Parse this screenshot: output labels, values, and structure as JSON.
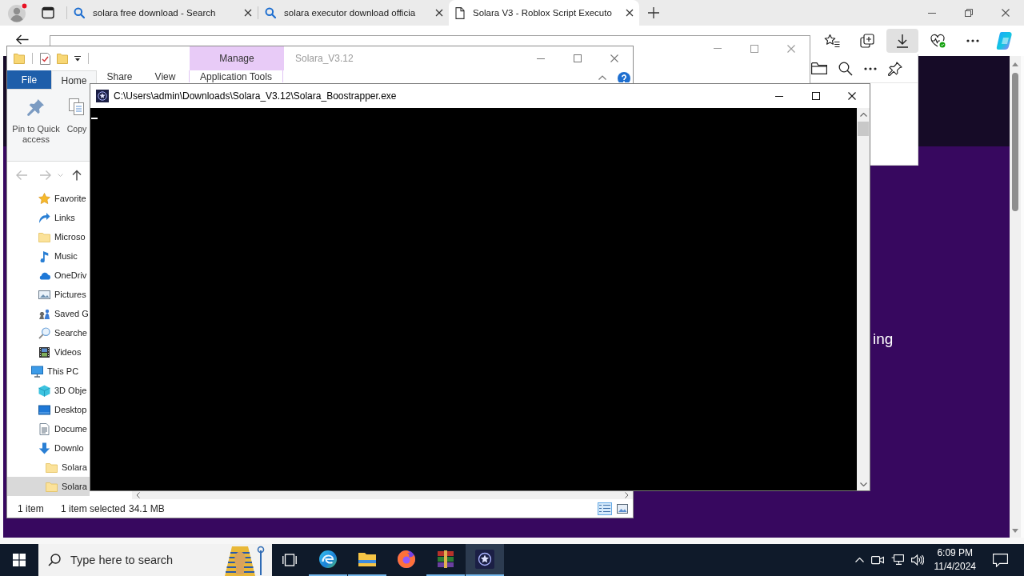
{
  "browser": {
    "tabs": [
      {
        "kind": "search",
        "title": "solara free download - Search",
        "selected": false
      },
      {
        "kind": "search",
        "title": "solara executor download officia",
        "selected": false
      },
      {
        "kind": "page",
        "title": "Solara V3 - Roblox Script Executo",
        "selected": true
      }
    ],
    "downloads_open": true,
    "page_text": "ing"
  },
  "explorer": {
    "context_group": "Manage",
    "title": "Solara_V3.12",
    "ribbon_tabs": [
      {
        "kind": "file",
        "label": "File",
        "selected": false
      },
      {
        "kind": "tab",
        "label": "Home",
        "selected": true
      },
      {
        "kind": "tab",
        "label": "Share",
        "selected": false
      },
      {
        "kind": "tab",
        "label": "View",
        "selected": false
      },
      {
        "kind": "context",
        "label": "Application Tools",
        "selected": false
      }
    ],
    "ribbon_commands": [
      {
        "kind": "pin",
        "label": "Pin to Quick access"
      },
      {
        "kind": "copy",
        "label": "Copy"
      }
    ],
    "nav_pane": {
      "branch_items": [
        {
          "kind": "star",
          "label": "Favorite",
          "selected": false
        },
        {
          "kind": "link",
          "label": "Links",
          "selected": false
        },
        {
          "kind": "folder",
          "label": "Microso",
          "selected": false
        },
        {
          "kind": "music",
          "label": "Music",
          "selected": false
        },
        {
          "kind": "cloud",
          "label": "OneDriv",
          "selected": false
        },
        {
          "kind": "pictures",
          "label": "Pictures",
          "selected": false
        },
        {
          "kind": "games",
          "label": "Saved G",
          "selected": false
        },
        {
          "kind": "search",
          "label": "Searche",
          "selected": false
        },
        {
          "kind": "videos",
          "label": "Videos",
          "selected": false
        }
      ],
      "tree": [
        {
          "kind": "pc",
          "label": "This PC",
          "selected": false,
          "children": [
            {
              "kind": "cube",
              "label": "3D Obje",
              "selected": false
            },
            {
              "kind": "desktop",
              "label": "Desktop",
              "selected": false
            },
            {
              "kind": "documents",
              "label": "Docume",
              "selected": false
            },
            {
              "kind": "downloads",
              "label": "Downlo",
              "selected": false,
              "children": [
                {
                  "kind": "folder",
                  "label": "Solara",
                  "selected": false
                },
                {
                  "kind": "folder",
                  "label": "Solara",
                  "selected": true
                }
              ]
            }
          ]
        }
      ]
    },
    "status": {
      "item_count": "1 item",
      "selection": "1 item selected",
      "size": "34.1 MB"
    },
    "view_modes": [
      {
        "kind": "details",
        "selected": true
      },
      {
        "kind": "large_icons",
        "selected": false
      }
    ]
  },
  "console": {
    "title": "C:\\Users\\admin\\Downloads\\Solara_V3.12\\Solara_Boostrapper.exe"
  },
  "taskbar": {
    "search": {
      "placeholder": "Type here to search"
    },
    "apps": [
      {
        "kind": "browser",
        "running": true,
        "selected": false
      },
      {
        "kind": "explorer",
        "running": true,
        "selected": false
      },
      {
        "kind": "firefox",
        "running": false,
        "selected": false
      },
      {
        "kind": "archiver",
        "running": true,
        "selected": false
      },
      {
        "kind": "solara",
        "running": true,
        "selected": true
      }
    ],
    "time": "6:09 PM",
    "date": "11/4/2024"
  }
}
